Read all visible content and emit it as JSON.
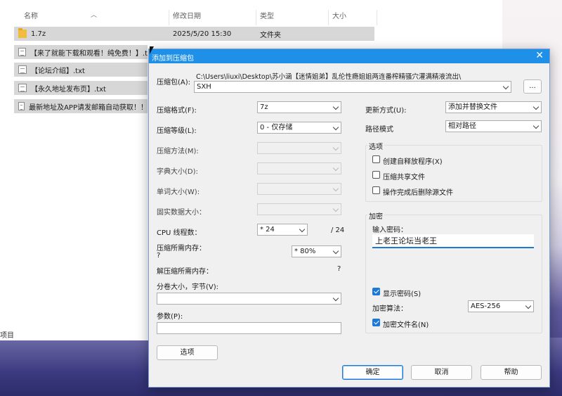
{
  "explorer": {
    "columns": {
      "name": "名称",
      "modified": "修改日期",
      "type": "类型",
      "size": "大小"
    },
    "files": [
      {
        "name": "1.7z",
        "date": "2025/5/20 15:30",
        "type": "文件夹",
        "icon": "folder-icon"
      },
      {
        "name": "【来了就能下载和观看！纯免费！】.t",
        "date": "",
        "type": "",
        "icon": "text-file-icon"
      },
      {
        "name": "【论坛介绍】.txt",
        "date": "",
        "type": "",
        "icon": "text-file-icon"
      },
      {
        "name": "【永久地址发布页】.txt",
        "date": "",
        "type": "",
        "icon": "text-file-icon"
      },
      {
        "name": "最新地址及APP请发邮箱自动获取！！",
        "date": "",
        "type": "",
        "icon": "text-file-icon"
      }
    ],
    "status": "项目"
  },
  "dialog": {
    "title": "添加到压缩包",
    "close": "✕",
    "archive_label": "压缩包(A):",
    "archive_path": "C:\\Users\\liuxi\\Desktop\\苏小涵【迷情姐弟】乱伦性瘾姐姐两连番榨精骚穴灌满精液流出\\",
    "archive_name": "SXH",
    "browse_label": "...",
    "format_label": "压缩格式(F):",
    "format_value": "7z",
    "level_label": "压缩等级(L):",
    "level_value": "0 - 仅存储",
    "method_label": "压缩方法(M):",
    "dict_label": "字典大小(D):",
    "word_label": "单词大小(W):",
    "solid_label": "固实数据大小：",
    "threads_label": "CPU 线程数：",
    "threads_value": "* 24",
    "threads_total": "/ 24",
    "mem_comp_label": "压缩所需内存：",
    "mem_comp_value": "?",
    "mem_pct": "* 80%",
    "mem_decomp_label": "解压缩所需内存：",
    "mem_decomp_value": "?",
    "volume_label": "分卷大小，字节(V):",
    "volume_value": "",
    "params_label": "参数(P):",
    "params_value": "",
    "options_button": "选项",
    "update_label": "更新方式(U):",
    "update_value": "添加并替换文件",
    "path_label": "路径模式",
    "path_value": "相对路径",
    "opts_group": "选项",
    "opt_sfx": "创建自释放程序(X)",
    "opt_shared": "压缩共享文件",
    "opt_delete": "操作完成后删除源文件",
    "enc_group": "加密",
    "enc_pw_label": "输入密码：",
    "enc_pw_value": "上老王论坛当老王",
    "enc_show": "显示密码(S)",
    "enc_method_label": "加密算法：",
    "enc_method_value": "AES-256",
    "enc_names": "加密文件名(N)",
    "ok": "确定",
    "cancel": "取消",
    "help": "帮助"
  }
}
